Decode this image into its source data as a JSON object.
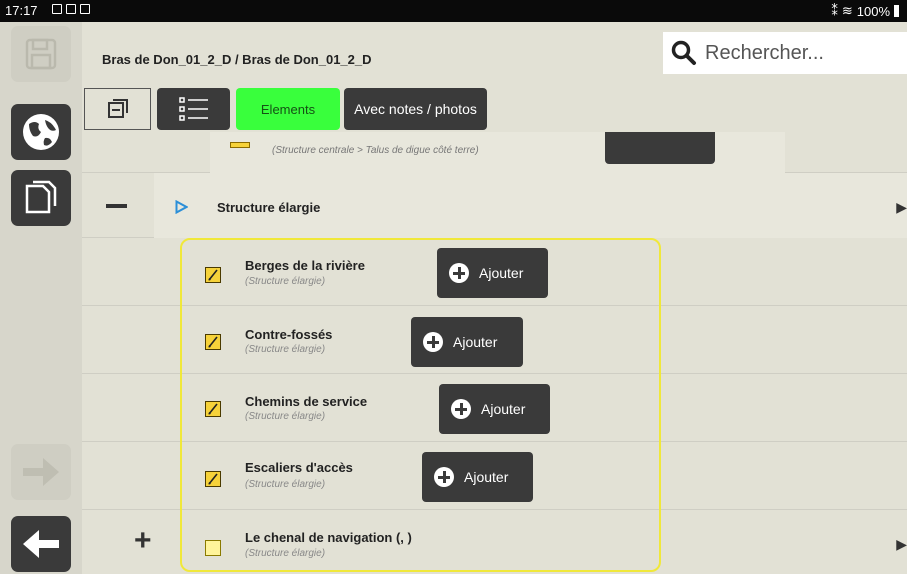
{
  "status_bar": {
    "time": "17:17",
    "battery": "100%"
  },
  "header": {
    "breadcrumb": "Bras de Don_01_2_D / Bras de Don_01_2_D"
  },
  "search": {
    "placeholder": "Rechercher..."
  },
  "toolbar": {
    "elements_label": "Elements",
    "notes_label": "Avec notes / photos"
  },
  "partial_row": {
    "subtitle": "(Structure centrale > Talus de digue côté terre)"
  },
  "group": {
    "label": "Structure élargie"
  },
  "items": [
    {
      "title": "Berges de la rivière",
      "subtitle": "(Structure élargie)",
      "button": "Ajouter"
    },
    {
      "title": "Contre-fossés",
      "subtitle": "(Structure élargie)",
      "button": "Ajouter"
    },
    {
      "title": "Chemins de service",
      "subtitle": "(Structure élargie)",
      "button": "Ajouter"
    },
    {
      "title": "Escaliers d'accès",
      "subtitle": "(Structure élargie)",
      "button": "Ajouter"
    },
    {
      "title": "Le chenal de navigation (, )",
      "subtitle": "(Structure élargie)"
    }
  ],
  "colors": {
    "accent_green": "#39ff3c",
    "highlight_yellow": "#f0e83a",
    "dark_button": "#3a3a3a"
  },
  "icons": [
    "save-icon",
    "globe-icon",
    "copy-icon",
    "forward-arrow-icon",
    "back-arrow-icon",
    "search-icon",
    "view-icon",
    "list-icon",
    "edit-icon",
    "triangle-right-icon",
    "chevron-right-icon",
    "plus-icon",
    "minus-icon"
  ]
}
